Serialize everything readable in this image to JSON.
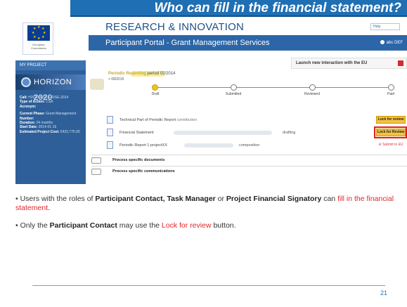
{
  "slide": {
    "title": "Who can fill in the financial statement?",
    "page_number": "21"
  },
  "portal": {
    "eu_caption": "European Commission",
    "header_title": "RESEARCH & INNOVATION",
    "subtitle": "Participant Portal - Grant Management Services",
    "language": "Help",
    "user": "abc DEF"
  },
  "sidebar": {
    "section": "MY PROJECT",
    "programme": "HORIZON 2020",
    "fields": [
      {
        "key": "Call:",
        "value": "H2020-MSCA-RISE-2014"
      },
      {
        "key": "Type of Action:",
        "value": "CSA"
      },
      {
        "key": "Acronym:",
        "value": ""
      },
      {
        "key": "Current Phase:",
        "value": "Grant Management"
      },
      {
        "key": "Number:",
        "value": ""
      },
      {
        "key": "Duration:",
        "value": "24 months"
      },
      {
        "key": "Start Date:",
        "value": "2014-01-15"
      },
      {
        "key": "Estimated Project Cost:",
        "value": "€422,775.00"
      }
    ]
  },
  "main": {
    "launch_label": "Launch new interaction with the EU",
    "process_title": "Periodic Reporting",
    "process_period": "period 02/2014",
    "process_sub": "> 08/2015",
    "timeline": [
      "Draft",
      "Submitted",
      "Reviewed",
      "Paid"
    ],
    "docs": [
      {
        "label": "Technical Part of Periodic Report",
        "status": "contribution",
        "action": "Lock for review"
      },
      {
        "label": "Financial Statement",
        "status": "drafting",
        "action": "Lock for Review"
      },
      {
        "label": "Periodic Report 1 projectXX",
        "status": "composition",
        "action": "Submit to EU"
      }
    ],
    "sections": [
      {
        "label": "Process specific documents"
      },
      {
        "label": "Process specific communications"
      }
    ]
  },
  "bullets": {
    "b1_pre": "Users with the roles of ",
    "b1_roles1": "Participant Contact, Task Manager",
    "b1_or": " or ",
    "b1_roles2": "Project Financial Signatory",
    "b1_can": " can ",
    "b1_action": "fill in the financial statement",
    "b1_end": ".",
    "b2_pre": "Only the ",
    "b2_role": "Participant Contact",
    "b2_mid": " may use the ",
    "b2_button": "Lock for review",
    "b2_end": " button."
  }
}
